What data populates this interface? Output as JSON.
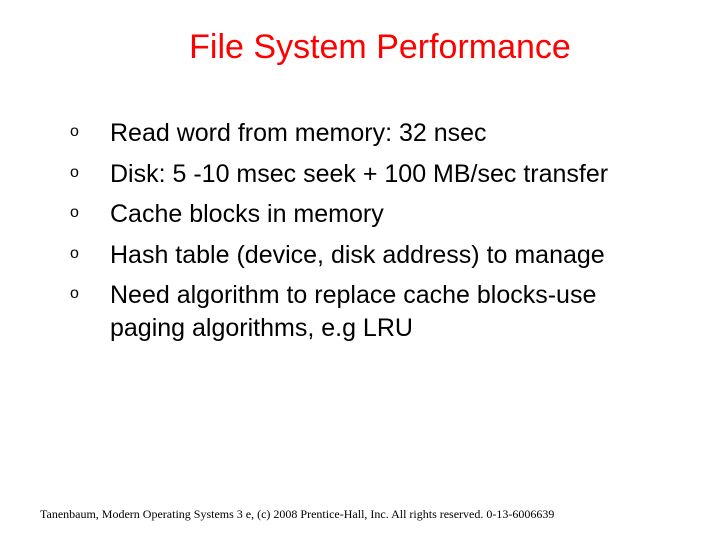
{
  "title": "File System Performance",
  "bullets": [
    "Read word from memory: 32 nsec",
    "Disk: 5 -10 msec seek + 100 MB/sec transfer",
    "Cache blocks in memory",
    "Hash table (device, disk address) to manage",
    "Need algorithm to replace cache blocks-use paging algorithms, e.g LRU"
  ],
  "footer": "Tanenbaum, Modern Operating Systems 3 e, (c) 2008 Prentice-Hall, Inc. All rights reserved. 0-13-6006639"
}
